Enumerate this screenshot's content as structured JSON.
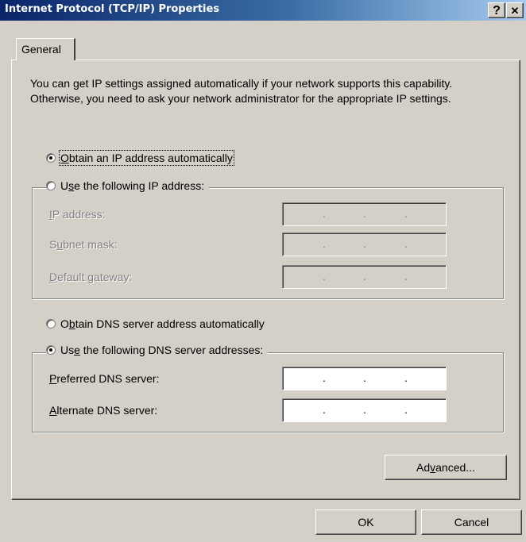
{
  "window": {
    "title": "Internet Protocol (TCP/IP) Properties",
    "help_button": "?",
    "close_button": "✕"
  },
  "tabs": [
    {
      "label": "General"
    }
  ],
  "intro_text": "You can get IP settings assigned automatically if your network supports this capability. Otherwise, you need to ask your network administrator for the appropriate IP settings.",
  "ip_settings": {
    "auto_option": {
      "pre": "",
      "accel": "O",
      "post": "btain an IP address automatically",
      "selected": true
    },
    "manual_option": {
      "pre": "U",
      "accel": "s",
      "post": "e the following IP address:",
      "selected": false
    },
    "fields": [
      {
        "pre": "",
        "accel": "I",
        "post": "P address:",
        "value": ". . ."
      },
      {
        "pre": "S",
        "accel": "u",
        "post": "bnet mask:",
        "value": ". . ."
      },
      {
        "pre": "",
        "accel": "D",
        "post": "efault gateway:",
        "value": ". . ."
      }
    ]
  },
  "dns_settings": {
    "auto_option": {
      "pre": "O",
      "accel": "b",
      "post": "tain DNS server address automatically",
      "selected": false
    },
    "manual_option": {
      "pre": "Us",
      "accel": "e",
      "post": " the following DNS server addresses:",
      "selected": true
    },
    "fields": [
      {
        "pre": "",
        "accel": "P",
        "post": "referred DNS server:",
        "value": ". . ."
      },
      {
        "pre": "",
        "accel": "A",
        "post": "lternate DNS server:",
        "value": ". . ."
      }
    ]
  },
  "buttons": {
    "advanced": {
      "pre": "Ad",
      "accel": "v",
      "post": "anced..."
    },
    "ok": "OK",
    "cancel": "Cancel"
  }
}
